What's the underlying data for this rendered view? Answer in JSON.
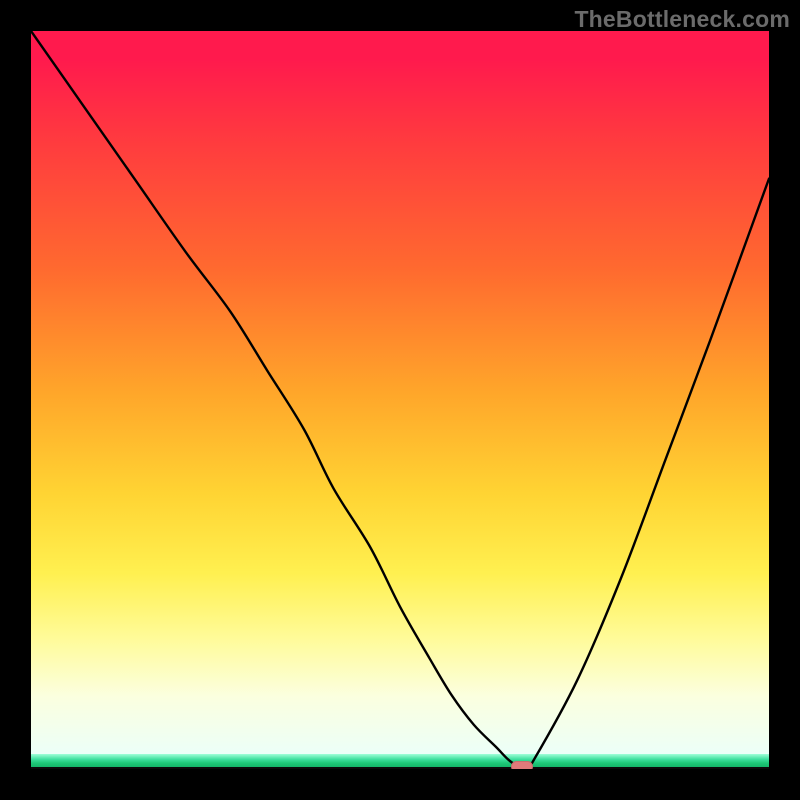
{
  "watermark": {
    "text": "TheBottleneck.com"
  },
  "colors": {
    "gradient_top": "#ff1a4d",
    "gradient_bottom": "#ecfff8",
    "green": "#1ec877",
    "marker": "#e17a7a",
    "curve": "#000000"
  },
  "chart_data": {
    "type": "line",
    "title": "",
    "xlabel": "",
    "ylabel": "",
    "xlim": [
      0,
      100
    ],
    "ylim": [
      0,
      100
    ],
    "grid": false,
    "legend": false,
    "background": "red-yellow-green vertical gradient",
    "series": [
      {
        "name": "bottleneck-curve",
        "x": [
          0,
          7,
          14,
          21,
          27,
          32,
          37,
          41,
          46,
          50,
          54,
          57,
          60,
          63,
          65,
          67,
          68,
          74,
          80,
          86,
          92,
          100
        ],
        "values": [
          100,
          90,
          80,
          70,
          62,
          54,
          46,
          38,
          30,
          22,
          15,
          10,
          6,
          3,
          1,
          0,
          1,
          12,
          26,
          42,
          58,
          80
        ]
      }
    ],
    "minimum_marker": {
      "x": 66.5,
      "y": 0
    },
    "green_band_y_range": [
      0,
      2
    ]
  }
}
